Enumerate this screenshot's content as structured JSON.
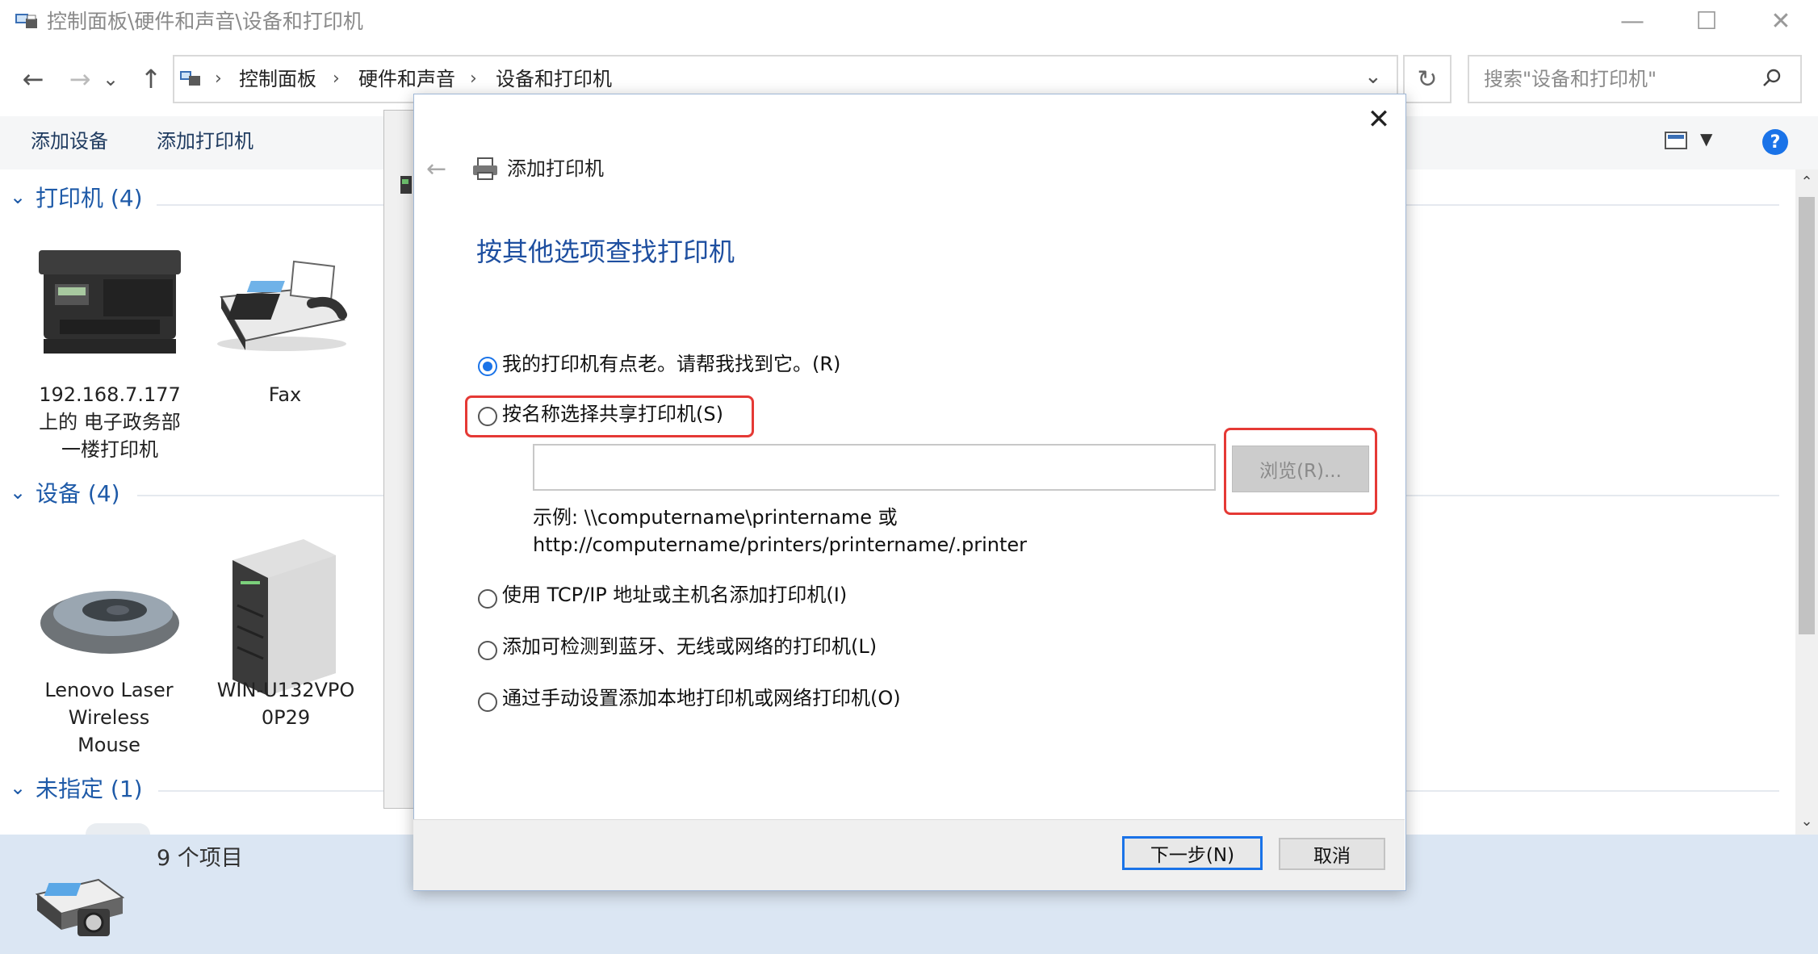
{
  "window": {
    "title": "控制面板\\硬件和声音\\设备和打印机",
    "minimize_glyph": "—",
    "maximize_glyph": "☐",
    "close_glyph": "✕"
  },
  "nav": {
    "back_glyph": "←",
    "forward_glyph": "→",
    "recent_glyph": "⌄",
    "up_glyph": "↑",
    "refresh_glyph": "↻"
  },
  "breadcrumb": {
    "items": [
      "控制面板",
      "硬件和声音",
      "设备和打印机"
    ],
    "separator": "›",
    "dropdown_glyph": "⌄"
  },
  "search": {
    "placeholder": "搜索\"设备和打印机\""
  },
  "toolbar": {
    "add_device": "添加设备",
    "add_printer": "添加打印机",
    "help_glyph": "?"
  },
  "groups": {
    "printers": {
      "title": "打印机 (4)",
      "devices": [
        "192.168.7.177\n上的 电子政务部\n一楼打印机",
        "Fax"
      ]
    },
    "devices": {
      "title": "设备 (4)",
      "devices": [
        "Lenovo Laser\nWireless\nMouse",
        "WIN-U132VPO\n0P29"
      ]
    },
    "unspecified": {
      "title": "未指定 (1)"
    }
  },
  "status": {
    "count": "9 个项目"
  },
  "dialog": {
    "title": "添加打印机",
    "heading": "按其他选项查找打印机",
    "options": [
      "我的打印机有点老。请帮我找到它。(R)",
      "按名称选择共享打印机(S)",
      "使用 TCP/IP 地址或主机名添加打印机(I)",
      "添加可检测到蓝牙、无线或网络的打印机(L)",
      "通过手动设置添加本地打印机或网络打印机(O)"
    ],
    "selected_option_index": 0,
    "share_name_value": "",
    "browse_label": "浏览(R)...",
    "example_line1": "示例: \\\\computername\\printername 或",
    "example_line2": "http://computername/printers/printername/.printer",
    "next_label": "下一步(N)",
    "cancel_label": "取消",
    "close_glyph": "✕",
    "back_glyph": "←"
  },
  "colors": {
    "accent": "#1a73e8",
    "heading_blue": "#1e4fa0",
    "group_blue": "#1e5aa8",
    "highlight_red": "#e53935",
    "status_bar": "#dbe6f3"
  }
}
